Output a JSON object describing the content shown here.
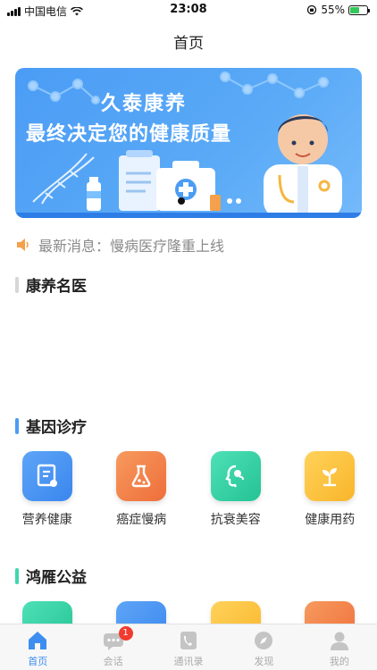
{
  "status_bar": {
    "carrier": "中国电信",
    "time": "23:08",
    "battery": "55%",
    "battery_level": 0.55
  },
  "nav": {
    "title": "首页"
  },
  "banner": {
    "title": "久泰康养",
    "subtitle": "最终决定您的健康质量"
  },
  "news": {
    "text": "最新消息：慢病医疗隆重上线"
  },
  "sections": {
    "doctors": {
      "label": "康养名医",
      "bar_color": "#d6d6d6"
    },
    "gene": {
      "label": "基因诊疗",
      "bar_color": "#4b9cf5"
    },
    "charity": {
      "label": "鸿雁公益",
      "bar_color": "#3fd6b0"
    }
  },
  "gene_items": [
    {
      "label": "营养健康",
      "icon": "document-icon",
      "color_from": "#5ea5f7",
      "color_to": "#3a86ee"
    },
    {
      "label": "癌症慢病",
      "icon": "flask-icon",
      "color_from": "#f79a5e",
      "color_to": "#ee6e3a"
    },
    {
      "label": "抗衰美容",
      "icon": "face-icon",
      "color_from": "#4fe0b7",
      "color_to": "#23c394"
    },
    {
      "label": "健康用药",
      "icon": "sprout-icon",
      "color_from": "#ffd25a",
      "color_to": "#f9b52a"
    }
  ],
  "charity_items": [
    {
      "icon": "bag-icon",
      "color_from": "#4fe0b7",
      "color_to": "#23c394"
    },
    {
      "icon": "folder-icon",
      "color_from": "#5ea5f7",
      "color_to": "#3a86ee"
    },
    {
      "icon": "pill-icon",
      "color_from": "#ffd25a",
      "color_to": "#f9b52a"
    },
    {
      "icon": "flag-icon",
      "color_from": "#f79a5e",
      "color_to": "#ee6e3a"
    }
  ],
  "tabs": [
    {
      "label": "首页",
      "icon": "home-icon",
      "active": true
    },
    {
      "label": "会话",
      "icon": "chat-icon",
      "badge": "1"
    },
    {
      "label": "通讯录",
      "icon": "contacts-icon"
    },
    {
      "label": "发现",
      "icon": "compass-icon"
    },
    {
      "label": "我的",
      "icon": "person-icon"
    }
  ],
  "colors": {
    "accent": "#3d8ef0",
    "muted": "#aaaaaa"
  }
}
